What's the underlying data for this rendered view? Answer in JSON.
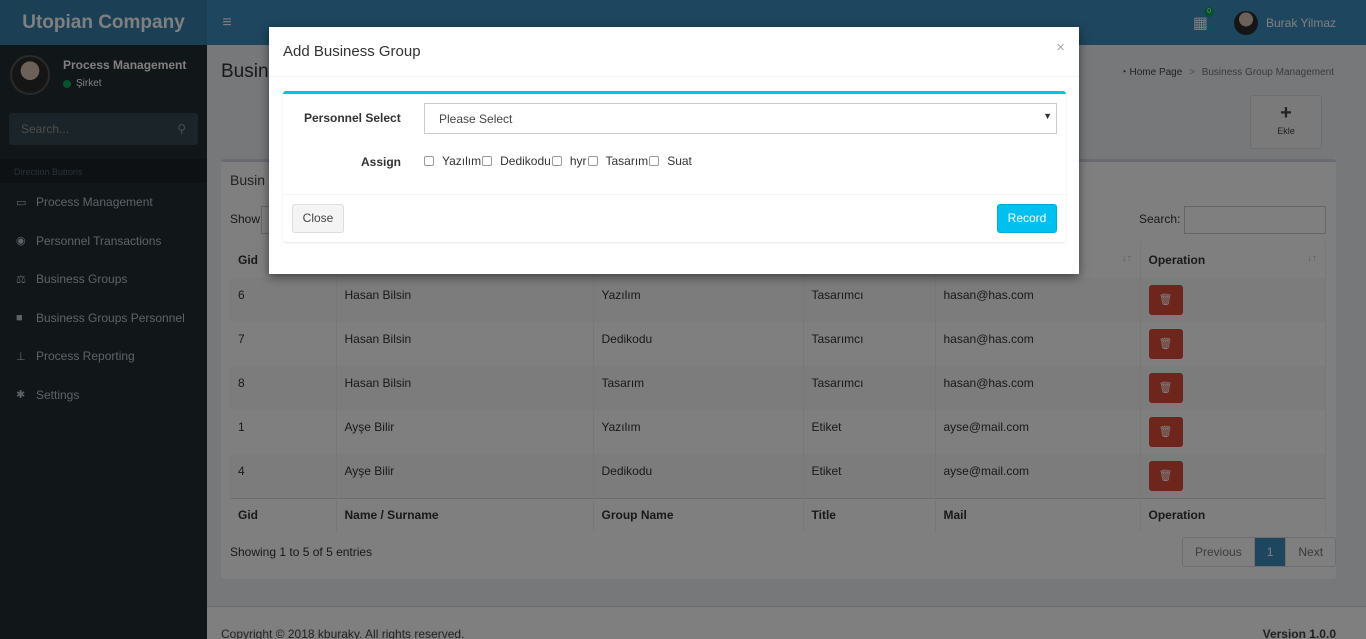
{
  "header": {
    "logo": "Utopian Company",
    "notif_count": "0",
    "user_name": "Burak Yilmaz"
  },
  "sidebar": {
    "user_name": "Process Management",
    "user_status": "Şirket",
    "search_placeholder": "Search...",
    "section_header": "Direction Buttons",
    "items": [
      {
        "label": "Process Management",
        "icon": "id-card-icon"
      },
      {
        "label": "Personnel Transactions",
        "icon": "map-pin-icon"
      },
      {
        "label": "Business Groups",
        "icon": "balance-scale-icon"
      },
      {
        "label": "Business Groups Personnel",
        "icon": "briefcase-icon"
      },
      {
        "label": "Process Reporting",
        "icon": "thumbtack-icon"
      },
      {
        "label": "Settings",
        "icon": "gear-icon"
      }
    ]
  },
  "page": {
    "title": "Busin",
    "breadcrumb_home": "Home Page",
    "breadcrumb_current": "Business Group Management",
    "add_label": "Ekle"
  },
  "table": {
    "box_title": "Busin",
    "show_label": "Show",
    "search_label": "Search:",
    "headers": [
      "Gid",
      "Name / Surname",
      "Group Name",
      "Title",
      "Mail",
      "Operation"
    ],
    "rows": [
      [
        "6",
        "Hasan Bilsin",
        "Yazılım",
        "Tasarımcı",
        "hasan@has.com"
      ],
      [
        "7",
        "Hasan Bilsin",
        "Dedikodu",
        "Tasarımcı",
        "hasan@has.com"
      ],
      [
        "8",
        "Hasan Bilsin",
        "Tasarım",
        "Tasarımcı",
        "hasan@has.com"
      ],
      [
        "1",
        "Ayşe Bilir",
        "Yazılım",
        "Etiket",
        "ayse@mail.com"
      ],
      [
        "4",
        "Ayşe Bilir",
        "Dedikodu",
        "Etiket",
        "ayse@mail.com"
      ]
    ],
    "info": "Showing 1 to 5 of 5 entries",
    "pager": {
      "prev": "Previous",
      "page": "1",
      "next": "Next"
    }
  },
  "footer": {
    "copyright": "Copyright © 2018 kburaky. All rights reserved.",
    "version": "Version 1.0.0"
  },
  "modal": {
    "title": "Add Business Group",
    "close_symbol": "×",
    "personnel_label": "Personnel Select",
    "select_value": "Please Select",
    "assign_label": "Assign",
    "options": [
      "Yazılım",
      "Dedikodu",
      "hyr",
      "Tasarım",
      "Suat"
    ],
    "close_button": "Close",
    "record_button": "Record"
  },
  "colors": {
    "header": "#3c8dbc",
    "sidebar": "#222d32",
    "accent": "#00c0ef",
    "danger": "#dd4b39"
  }
}
